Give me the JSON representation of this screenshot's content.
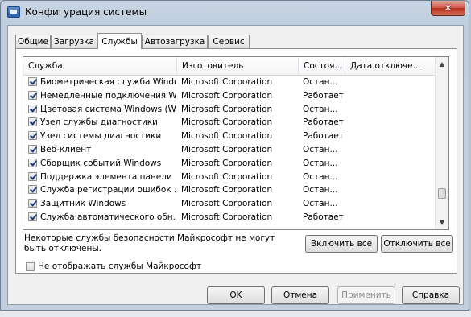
{
  "window": {
    "title": "Конфигурация системы",
    "close_glyph": "✕"
  },
  "tabs": [
    {
      "label": "Общие",
      "active": false
    },
    {
      "label": "Загрузка",
      "active": false
    },
    {
      "label": "Службы",
      "active": true
    },
    {
      "label": "Автозагрузка",
      "active": false
    },
    {
      "label": "Сервис",
      "active": false
    }
  ],
  "services_table": {
    "columns": [
      "Служба",
      "Изготовитель",
      "Состоя...",
      "Дата отключе..."
    ],
    "rows": [
      {
        "checked": true,
        "service": "Биометрическая служба Windo...",
        "manufacturer": "Microsoft Corporation",
        "status": "Остан..."
      },
      {
        "checked": true,
        "service": "Немедленные подключения W...",
        "manufacturer": "Microsoft Corporation",
        "status": "Работает"
      },
      {
        "checked": true,
        "service": "Цветовая система Windows (W...",
        "manufacturer": "Microsoft Corporation",
        "status": "Остан..."
      },
      {
        "checked": true,
        "service": "Узел службы диагностики",
        "manufacturer": "Microsoft Corporation",
        "status": "Работает"
      },
      {
        "checked": true,
        "service": "Узел системы диагностики",
        "manufacturer": "Microsoft Corporation",
        "status": "Работает"
      },
      {
        "checked": true,
        "service": "Веб-клиент",
        "manufacturer": "Microsoft Corporation",
        "status": "Остан..."
      },
      {
        "checked": true,
        "service": "Сборщик событий Windows",
        "manufacturer": "Microsoft Corporation",
        "status": "Остан..."
      },
      {
        "checked": true,
        "service": "Поддержка элемента панели ...",
        "manufacturer": "Microsoft Corporation",
        "status": "Остан..."
      },
      {
        "checked": true,
        "service": "Служба регистрации ошибок ...",
        "manufacturer": "Microsoft Corporation",
        "status": "Остан..."
      },
      {
        "checked": true,
        "service": "Защитник Windows",
        "manufacturer": "Microsoft Corporation",
        "status": "Остан..."
      },
      {
        "checked": true,
        "service": "Служба автоматического обн...",
        "manufacturer": "Microsoft Corporation",
        "status": "Работает"
      }
    ]
  },
  "note": "Некоторые службы безопасности Майкрософт не могут быть отключены.",
  "buttons": {
    "enable_all": "Включить все",
    "disable_all": "Отключить все",
    "ok": "OK",
    "cancel": "Отмена",
    "apply": "Применить",
    "help": "Справка"
  },
  "hide_ms_checkbox": {
    "label": "Не отображать службы Майкрософт",
    "checked": false
  },
  "scrollbar": {
    "up_glyph": "▲",
    "down_glyph": "▼"
  }
}
